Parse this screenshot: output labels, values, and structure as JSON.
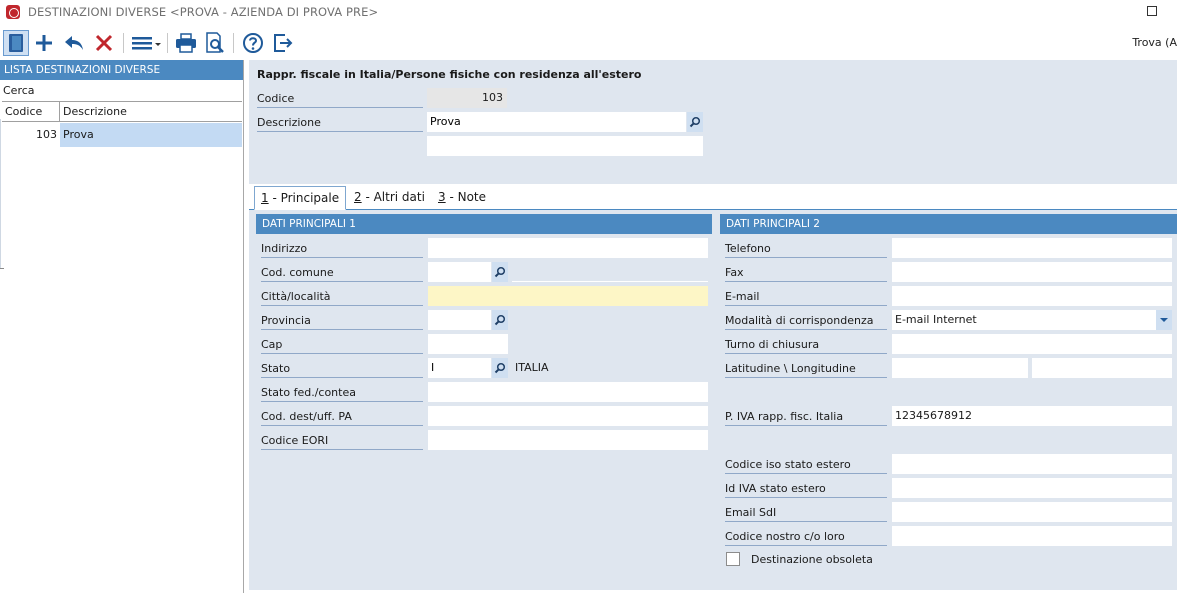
{
  "window": {
    "title": "DESTINAZIONI DIVERSE <PROVA - AZIENDA DI PROVA PRE>"
  },
  "toolbar": {
    "icons": [
      "panel-toggle-icon",
      "plus-icon",
      "undo-icon",
      "delete-icon",
      "menu-icon",
      "print-icon",
      "print-preview-icon",
      "help-icon",
      "exit-icon"
    ],
    "right_text": "Trova (A"
  },
  "list": {
    "header": "LISTA DESTINAZIONI DIVERSE",
    "search_label": "Cerca",
    "search_value": "",
    "columns": [
      "Codice",
      "Descrizione"
    ],
    "rows": [
      {
        "codice": "103",
        "descrizione": "Prova"
      }
    ]
  },
  "main": {
    "title": "Rappr. fiscale in Italia/Persone fisiche con residenza all'estero",
    "codice_label": "Codice",
    "codice_value": "103",
    "descrizione_label": "Descrizione",
    "descrizione_value": "Prova",
    "descrizione2_value": ""
  },
  "tabs": [
    {
      "key": "1",
      "label": " - Principale"
    },
    {
      "key": "2",
      "label": " - Altri dati"
    },
    {
      "key": "3",
      "label": " - Note"
    }
  ],
  "section1": {
    "header": "DATI PRINCIPALI 1",
    "indirizzo_label": "Indirizzo",
    "indirizzo_value": "",
    "cod_comune_label": "Cod. comune",
    "cod_comune_value": "",
    "comune_desc": "",
    "citta_label": "Città/località",
    "citta_value": "",
    "provincia_label": "Provincia",
    "provincia_value": "",
    "cap_label": "Cap",
    "cap_value": "",
    "stato_label": "Stato",
    "stato_value": "I",
    "stato_desc": "ITALIA",
    "stato_fed_label": "Stato fed./contea",
    "stato_fed_value": "",
    "cod_dest_label": "Cod. dest/uff. PA",
    "cod_dest_value": "",
    "eori_label": "Codice EORI",
    "eori_value": ""
  },
  "section2": {
    "header": "DATI PRINCIPALI 2",
    "telefono_label": "Telefono",
    "telefono_value": "",
    "fax_label": "Fax",
    "fax_value": "",
    "email_label": "E-mail",
    "email_value": "",
    "modalita_label": "Modalità di corrispondenza",
    "modalita_value": "E-mail Internet",
    "turno_label": "Turno di chiusura",
    "turno_value": "",
    "latlon_label": "Latitudine \\ Longitudine",
    "lat_value": "",
    "lon_value": "",
    "piva_label": "P. IVA rapp. fisc. Italia",
    "piva_value": "12345678912",
    "iso_label": "Codice iso stato estero",
    "iso_value": "",
    "idiva_label": "Id IVA stato estero",
    "idiva_value": "",
    "sdi_label": "Email SdI",
    "sdi_value": "",
    "nostro_label": "Codice nostro c/o loro",
    "nostro_value": "",
    "obsoleta_label": "Destinazione obsoleta",
    "obsoleta_checked": false
  },
  "colors": {
    "accent": "#4b89c1",
    "panel_bg": "#dfe6ef",
    "selected_row": "#c3daf3",
    "required_field": "#fdf6c6"
  }
}
